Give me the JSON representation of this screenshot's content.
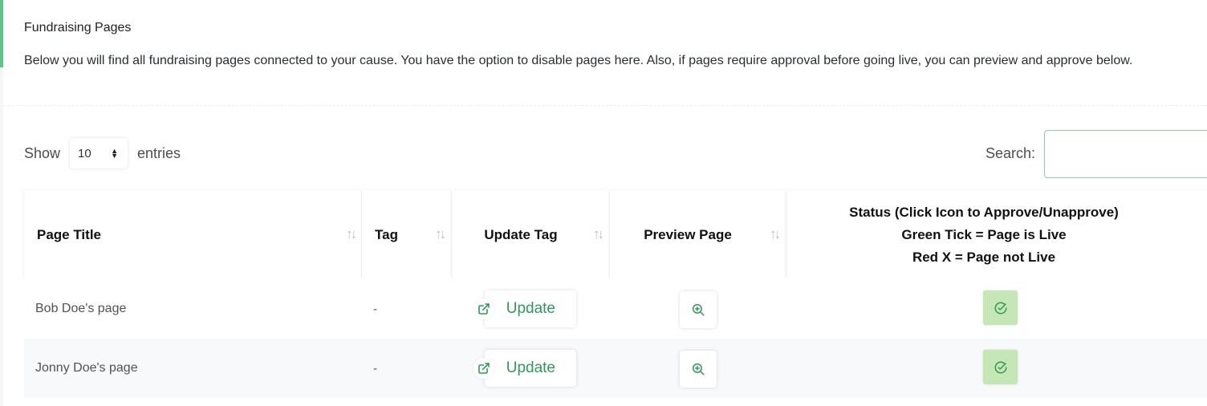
{
  "section": {
    "title": "Fundraising Pages",
    "description": "Below you will find all fundraising pages connected to your cause. You have the option to disable pages here. Also, if pages require approval before going live, you can preview and approve below."
  },
  "length_menu": {
    "prefix": "Show",
    "value": "10",
    "suffix": "entries"
  },
  "search": {
    "label": "Search:",
    "value": ""
  },
  "table": {
    "headers": {
      "page_title": "Page Title",
      "tag": "Tag",
      "update_tag": "Update Tag",
      "preview_page": "Preview Page",
      "status_line1": "Status (Click Icon to Approve/Unapprove)",
      "status_line2": "Green Tick = Page is Live",
      "status_line3": "Red X = Page not Live"
    },
    "rows": [
      {
        "title": "Bob Doe's page",
        "tag": "-",
        "update_label": "Update",
        "status": "live"
      },
      {
        "title": "Jonny Doe's page",
        "tag": "-",
        "update_label": "Update",
        "status": "live"
      }
    ]
  },
  "icons": {
    "sort": "sort-icon",
    "external_link": "external-link-icon",
    "zoom_in": "zoom-in-icon",
    "check_circle": "check-circle-icon"
  },
  "colors": {
    "accent": "#5cc485",
    "update_text": "#2f9a5a",
    "status_live_bg": "#c5e6b5",
    "status_live_icon": "#2e9a55"
  }
}
